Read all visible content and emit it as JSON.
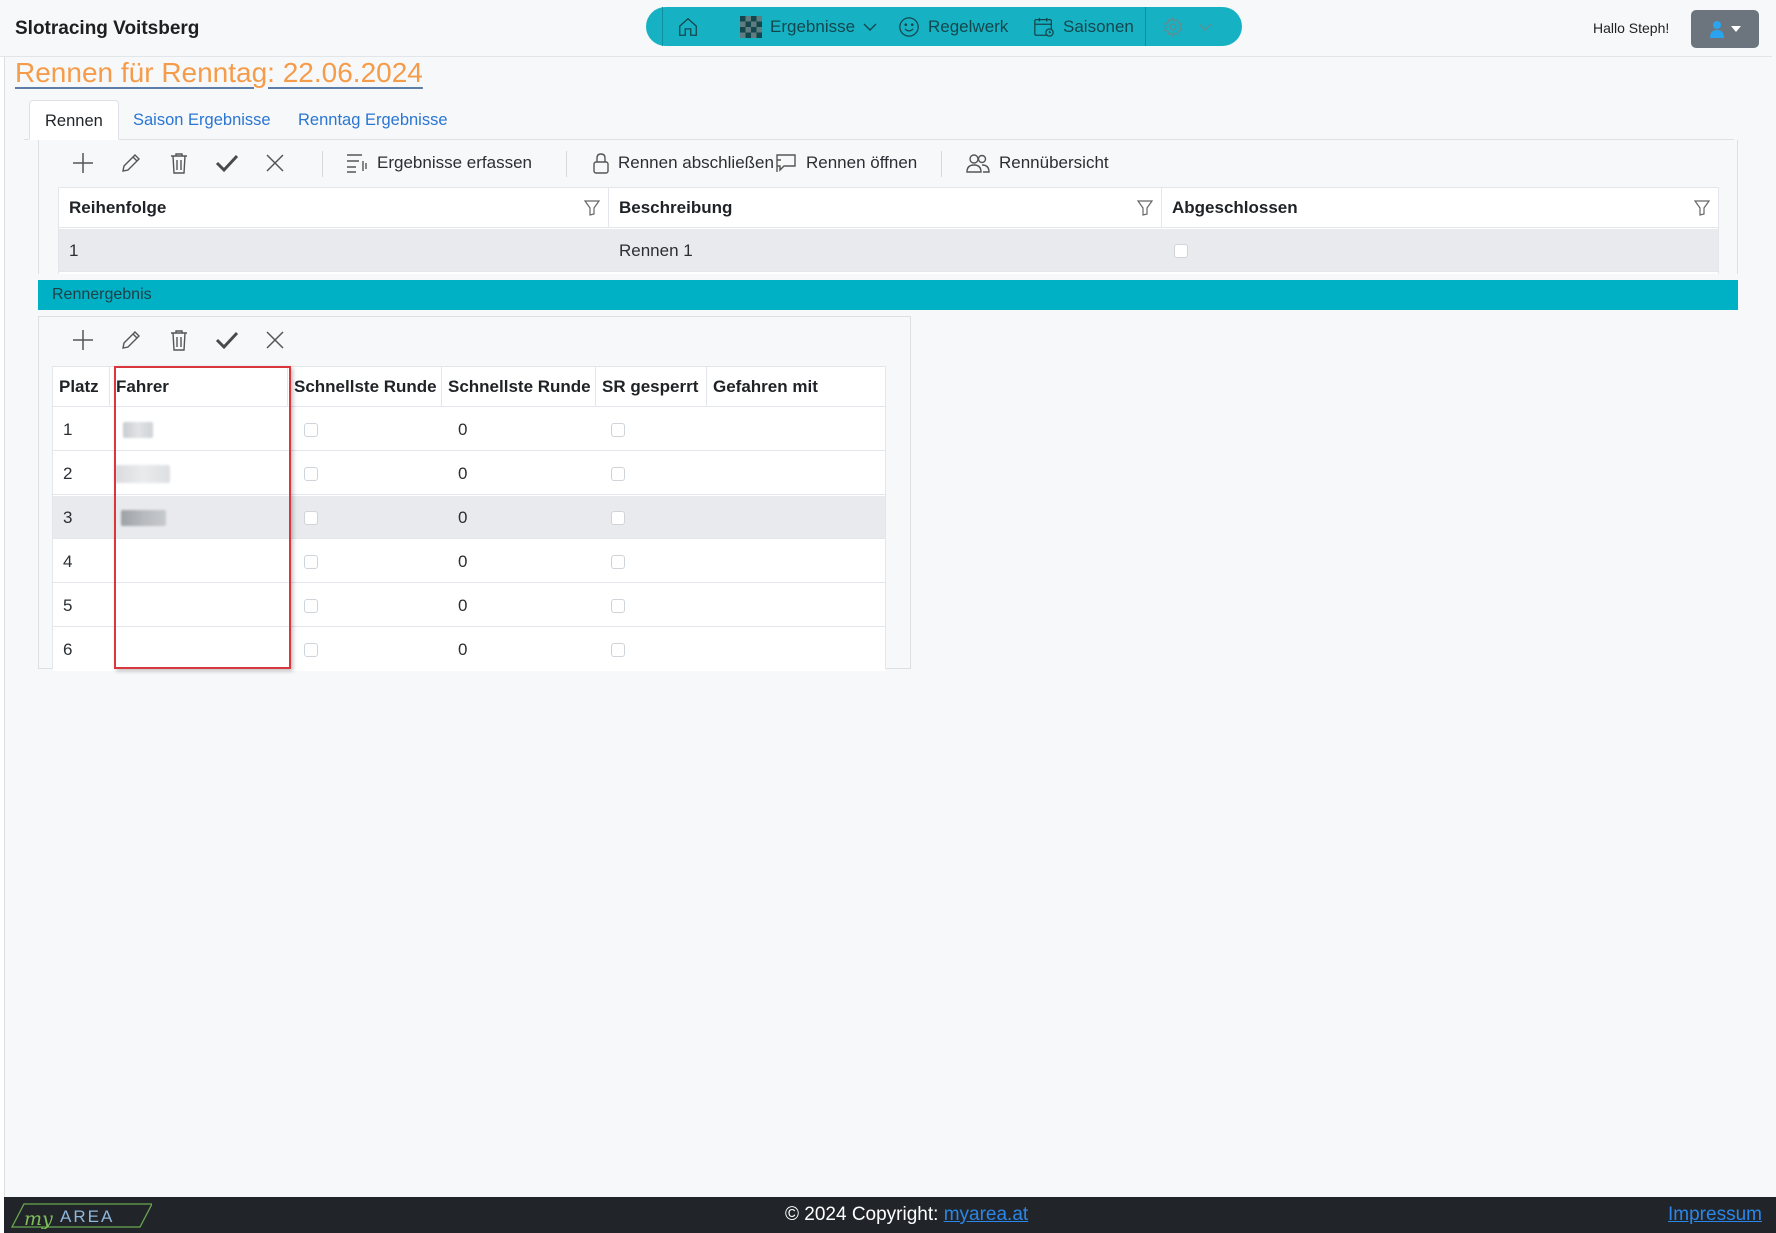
{
  "brand": "Slotracing Voitsberg",
  "nav": {
    "items": [
      {
        "label": "Ergebnisse",
        "icon": "checkered-flag-icon"
      },
      {
        "label": "Regelwerk",
        "icon": "smiley-icon"
      },
      {
        "label": "Saisonen",
        "icon": "calendar-icon"
      }
    ]
  },
  "greeting": "Hallo Steph!",
  "page_title": "Rennen für Renntag: 22.06.2024",
  "tabs": [
    "Rennen",
    "Saison Ergebnisse",
    "Renntag Ergebnisse"
  ],
  "races_toolbar": {
    "erfassen": "Ergebnisse erfassen",
    "abschliessen": "Rennen abschließen",
    "oeffnen": "Rennen öffnen",
    "uebersicht": "Rennübersicht"
  },
  "races_grid": {
    "columns": [
      "Reihenfolge",
      "Beschreibung",
      "Abgeschlossen"
    ],
    "rows": [
      {
        "reihenfolge": "1",
        "beschreibung": "Rennen 1",
        "abgeschlossen": false
      }
    ]
  },
  "section_title": "Rennergebnis",
  "results_grid": {
    "columns": [
      "Platz",
      "Fahrer",
      "Schnellste Runde",
      "Schnellste Runde",
      "SR gesperrt",
      "Gefahren mit"
    ],
    "rows": [
      {
        "platz": "1",
        "fahrer_blurred": true,
        "sr": "0"
      },
      {
        "platz": "2",
        "fahrer_blurred": true,
        "sr": "0"
      },
      {
        "platz": "3",
        "fahrer_blurred": true,
        "sr": "0",
        "selected": true
      },
      {
        "platz": "4",
        "fahrer_blurred": false,
        "sr": "0"
      },
      {
        "platz": "5",
        "fahrer_blurred": false,
        "sr": "0"
      },
      {
        "platz": "6",
        "fahrer_blurred": false,
        "sr": "0"
      }
    ]
  },
  "footer": {
    "copyright": "© 2024 Copyright: ",
    "link": "myarea.at",
    "impressum": "Impressum",
    "logo_text": "myAREA"
  },
  "colors": {
    "accent": "#16b2c4",
    "section_bar": "#00b0c4",
    "title": "#f59c4a",
    "link": "#2a76d2",
    "highlight": "#d9363e"
  }
}
